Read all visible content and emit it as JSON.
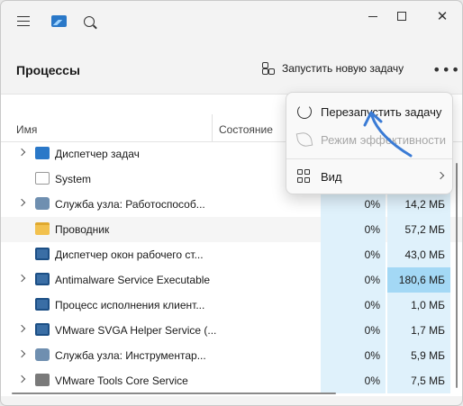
{
  "titlebar": {
    "icons": [
      "hamburger-menu-icon",
      "task-manager-app-icon",
      "search-icon"
    ],
    "controls": [
      "minimize",
      "maximize",
      "close"
    ]
  },
  "header": {
    "title": "Процессы",
    "run_new_task_label": "Запустить новую задачу",
    "more_icon": "more-dots-icon"
  },
  "table": {
    "columns": {
      "name": "Имя",
      "status": "Состояние"
    },
    "rows": [
      {
        "name": "Диспетчер задач",
        "icon": "taskmgr",
        "expandable": true,
        "cpu": "",
        "memory": ""
      },
      {
        "name": "System",
        "icon": "blank",
        "expandable": false,
        "cpu": "",
        "memory": ""
      },
      {
        "name": "Служба узла: Работоспособ...",
        "icon": "gear",
        "expandable": true,
        "cpu": "0%",
        "memory": "14,2 МБ"
      },
      {
        "name": "Проводник",
        "icon": "folder",
        "expandable": false,
        "cpu": "0%",
        "memory": "57,2 МБ"
      },
      {
        "name": "Диспетчер окон рабочего ст...",
        "icon": "service",
        "expandable": false,
        "cpu": "0%",
        "memory": "43,0 МБ"
      },
      {
        "name": "Antimalware Service Executable",
        "icon": "service",
        "expandable": true,
        "cpu": "0%",
        "memory": "180,6 МБ"
      },
      {
        "name": "Процесс исполнения клиент...",
        "icon": "service",
        "expandable": false,
        "cpu": "0%",
        "memory": "1,0 МБ"
      },
      {
        "name": "VMware SVGA Helper Service (...",
        "icon": "service",
        "expandable": true,
        "cpu": "0%",
        "memory": "1,7 МБ"
      },
      {
        "name": "Служба узла: Инструментар...",
        "icon": "gear",
        "expandable": true,
        "cpu": "0%",
        "memory": "5,9 МБ"
      },
      {
        "name": "VMware Tools Core Service",
        "icon": "vm",
        "expandable": true,
        "cpu": "0%",
        "memory": "7,5 МБ"
      }
    ]
  },
  "context_menu": {
    "items": [
      {
        "label": "Перезапустить задачу",
        "icon": "restart-icon",
        "disabled": false
      },
      {
        "label": "Режим эффективности",
        "icon": "leaf-icon",
        "disabled": true
      },
      {
        "label": "Вид",
        "icon": "view-grid-icon",
        "disabled": false,
        "submenu": true
      }
    ]
  },
  "colors": {
    "accent": "#2a78c8",
    "highlight_column": "#dff1fb",
    "hot_cell": "#a3d8f5",
    "annotation_arrow": "#3a7bd5"
  }
}
